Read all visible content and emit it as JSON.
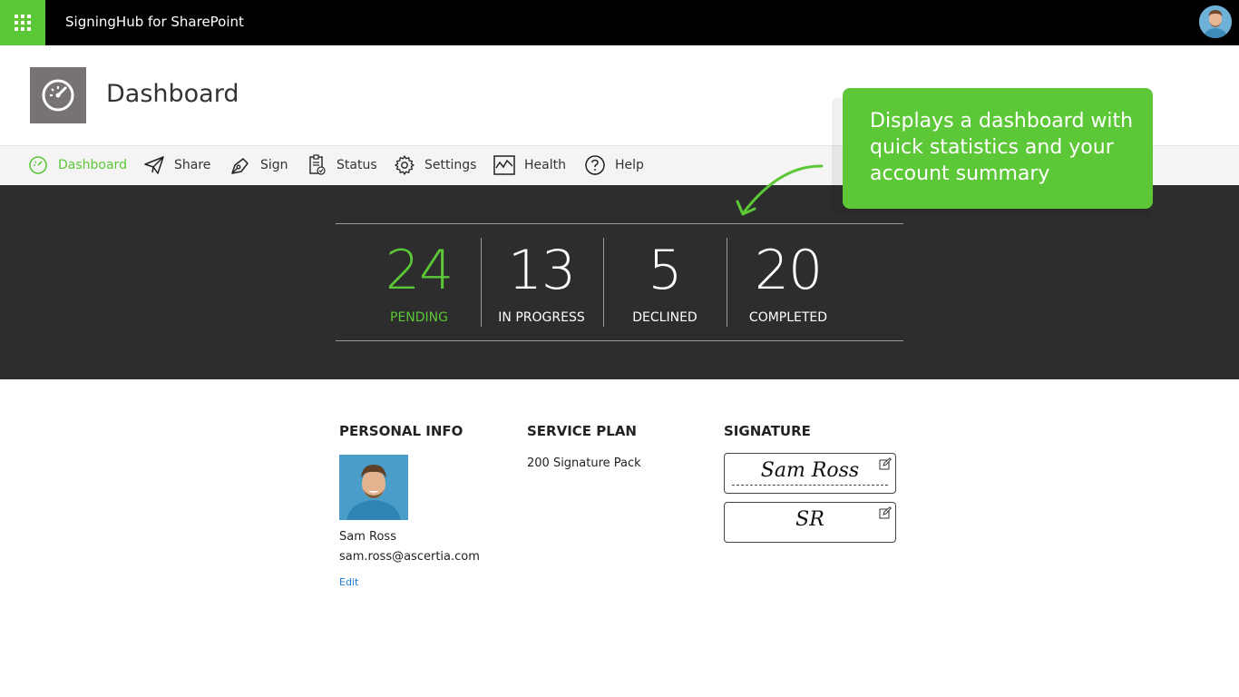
{
  "topbar": {
    "app_title": "SigningHub for SharePoint",
    "waffle_icon": "waffle-icon",
    "avatar": "user-avatar"
  },
  "header": {
    "title": "Dashboard",
    "icon": "speedometer-icon"
  },
  "nav": {
    "items": [
      {
        "label": "Dashboard",
        "icon": "dashboard-icon",
        "active": true
      },
      {
        "label": "Share",
        "icon": "paper-plane-icon"
      },
      {
        "label": "Sign",
        "icon": "pen-icon"
      },
      {
        "label": "Status",
        "icon": "clipboard-icon"
      },
      {
        "label": "Settings",
        "icon": "gear-icon"
      },
      {
        "label": "Health",
        "icon": "pulse-icon"
      },
      {
        "label": "Help",
        "icon": "question-icon"
      }
    ]
  },
  "stats": [
    {
      "value": "24",
      "label": "PENDING"
    },
    {
      "value": "13",
      "label": "IN PROGRESS"
    },
    {
      "value": "5",
      "label": "DECLINED"
    },
    {
      "value": "20",
      "label": "COMPLETED"
    }
  ],
  "callout": {
    "text": "Displays a dashboard with quick statistics and your account summary"
  },
  "personal_info": {
    "title": "PERSONAL INFO",
    "name": "Sam Ross",
    "email": "sam.ross@ascertia.com",
    "edit_label": "Edit"
  },
  "service_plan": {
    "title": "SERVICE PLAN",
    "plan": "200 Signature Pack"
  },
  "signature": {
    "title": "SIGNATURE",
    "full_signature": "Sam Ross",
    "initials": "SR"
  },
  "colors": {
    "accent": "#5cc837",
    "topbar": "#000000",
    "stats_bg": "#2d2d2d",
    "link": "#1a7bd6"
  }
}
